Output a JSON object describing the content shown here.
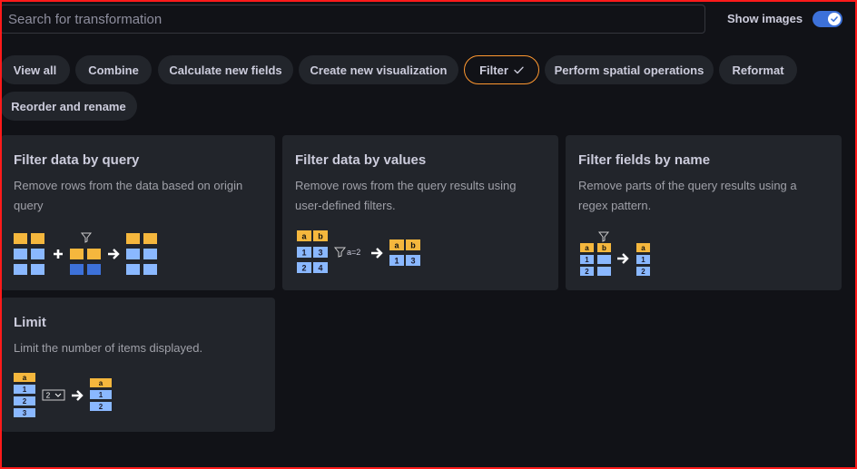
{
  "search": {
    "placeholder": "Search for transformation",
    "value": ""
  },
  "show_images": {
    "label": "Show images",
    "enabled": true
  },
  "filter_chips": [
    {
      "label": "View all",
      "active": false
    },
    {
      "label": "Combine",
      "active": false
    },
    {
      "label": "Calculate new fields",
      "active": false
    },
    {
      "label": "Create new visualization",
      "active": false
    },
    {
      "label": "Filter",
      "active": true
    },
    {
      "label": "Perform spatial operations",
      "active": false
    },
    {
      "label": "Reformat",
      "active": false
    },
    {
      "label": "Reorder and rename",
      "active": false
    }
  ],
  "cards": [
    {
      "title": "Filter data by query",
      "description": "Remove rows from the data based on origin query",
      "illustration": "filter-by-query"
    },
    {
      "title": "Filter data by values",
      "description": "Remove rows from the query results using user-defined filters.",
      "illustration": "filter-by-values",
      "labels": {
        "a": "a",
        "b": "b",
        "r1a": "1",
        "r1b": "3",
        "r2a": "2",
        "r2b": "4",
        "condition": "a=2"
      }
    },
    {
      "title": "Filter fields by name",
      "description": "Remove parts of the query results using a regex pattern.",
      "illustration": "filter-by-name",
      "labels": {
        "a": "a",
        "b": "b",
        "r1": "1",
        "r2": "2"
      }
    },
    {
      "title": "Limit",
      "description": "Limit the number of items displayed.",
      "illustration": "limit",
      "labels": {
        "a": "a",
        "r1": "1",
        "r2": "2",
        "r3": "3",
        "limit": "2"
      }
    }
  ],
  "colors": {
    "accent_orange": "#ff9830",
    "cell_yellow": "#f5b73d",
    "cell_blue": "#8ab8ff",
    "cell_dark_blue": "#3d71d9",
    "toggle_blue": "#3d71d9"
  }
}
